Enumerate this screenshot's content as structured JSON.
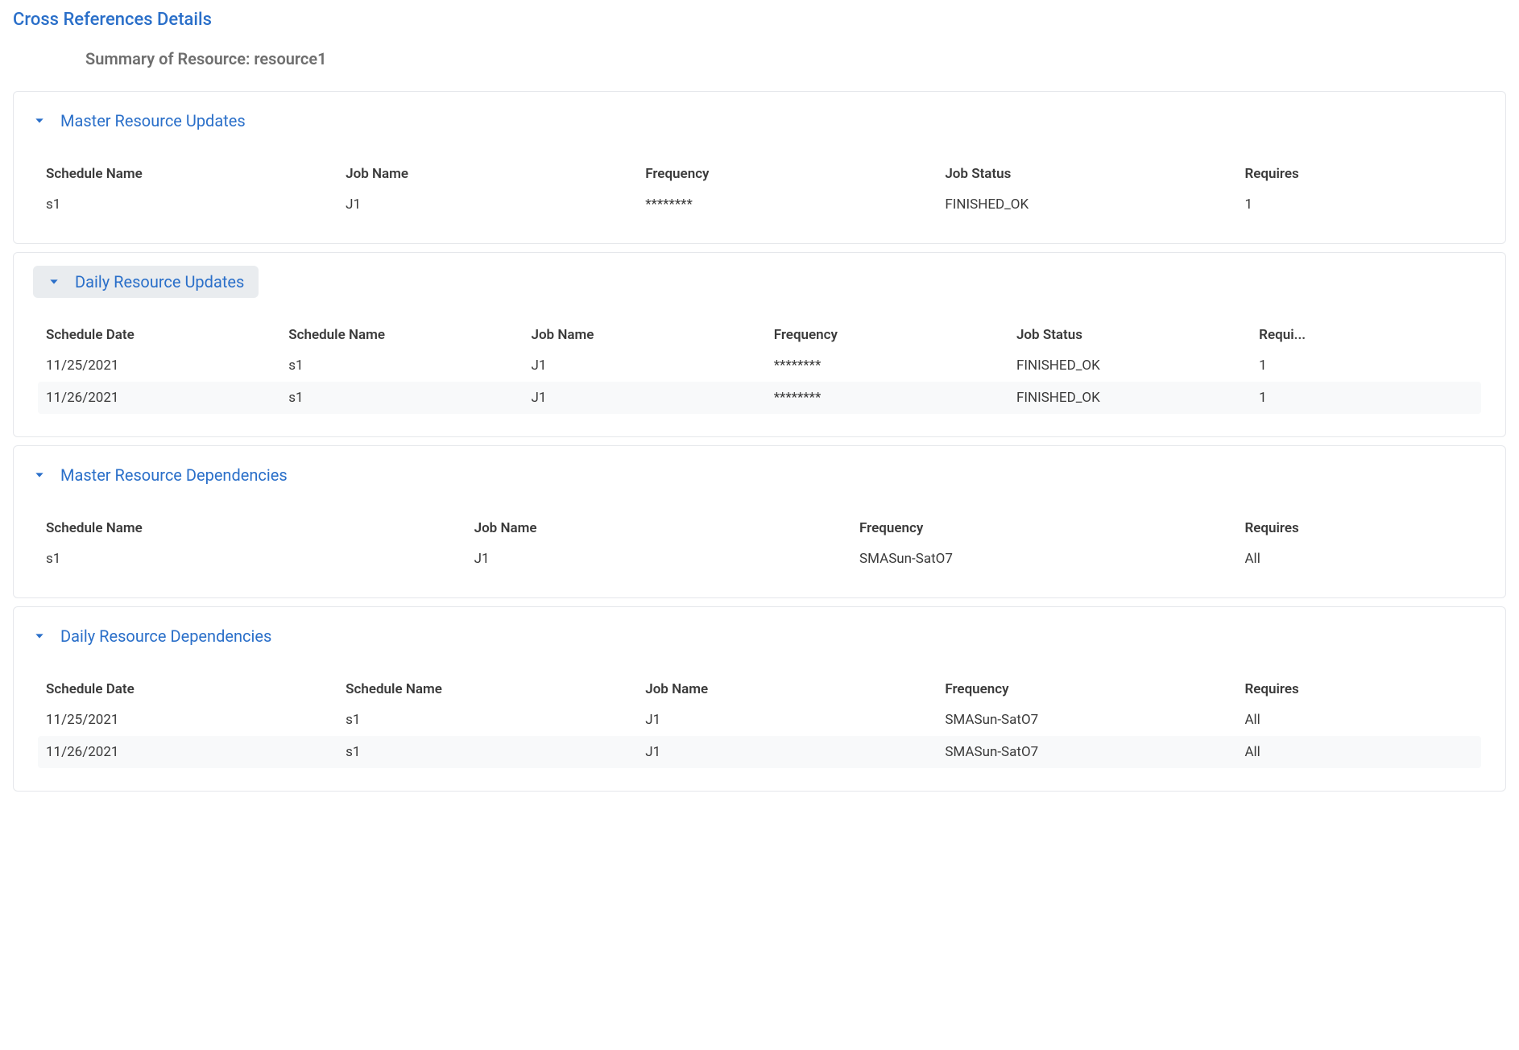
{
  "page_title": "Cross References Details",
  "summary": "Summary of Resource: resource1",
  "sections": {
    "master_updates": {
      "title": "Master Resource Updates",
      "headers": [
        "Schedule Name",
        "Job Name",
        "Frequency",
        "Job Status",
        "Requires"
      ],
      "rows": [
        {
          "schedule_name": "s1",
          "job_name": "J1",
          "frequency": "********",
          "job_status": "FINISHED_OK",
          "requires": "1"
        }
      ]
    },
    "daily_updates": {
      "title": "Daily Resource Updates",
      "headers": [
        "Schedule Date",
        "Schedule Name",
        "Job Name",
        "Frequency",
        "Job Status",
        "Requi..."
      ],
      "rows": [
        {
          "schedule_date": "11/25/2021",
          "schedule_name": "s1",
          "job_name": "J1",
          "frequency": "********",
          "job_status": "FINISHED_OK",
          "requires": "1"
        },
        {
          "schedule_date": "11/26/2021",
          "schedule_name": "s1",
          "job_name": "J1",
          "frequency": "********",
          "job_status": "FINISHED_OK",
          "requires": "1"
        }
      ]
    },
    "master_dependencies": {
      "title": "Master Resource Dependencies",
      "headers": [
        "Schedule Name",
        "Job Name",
        "Frequency",
        "Requires"
      ],
      "rows": [
        {
          "schedule_name": "s1",
          "job_name": "J1",
          "frequency": "SMASun-SatO7",
          "requires": "All"
        }
      ]
    },
    "daily_dependencies": {
      "title": "Daily Resource Dependencies",
      "headers": [
        "Schedule Date",
        "Schedule Name",
        "Job Name",
        "Frequency",
        "Requires"
      ],
      "rows": [
        {
          "schedule_date": "11/25/2021",
          "schedule_name": "s1",
          "job_name": "J1",
          "frequency": "SMASun-SatO7",
          "requires": "All"
        },
        {
          "schedule_date": "11/26/2021",
          "schedule_name": "s1",
          "job_name": "J1",
          "frequency": "SMASun-SatO7",
          "requires": "All"
        }
      ]
    }
  }
}
